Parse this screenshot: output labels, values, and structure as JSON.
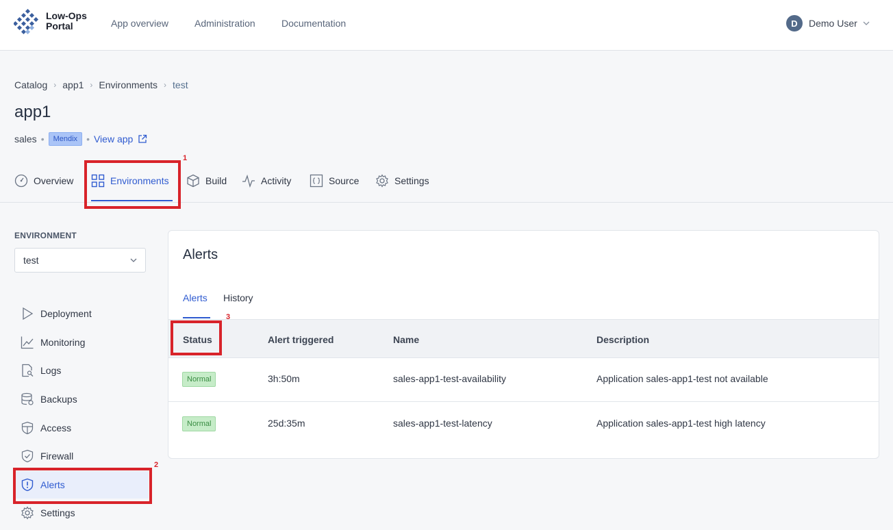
{
  "brand": {
    "line1": "Low-Ops",
    "line2": "Portal"
  },
  "topnav": {
    "links": [
      "App overview",
      "Administration",
      "Documentation"
    ]
  },
  "user": {
    "initial": "D",
    "name": "Demo User"
  },
  "breadcrumb": [
    "Catalog",
    "app1",
    "Environments",
    "test"
  ],
  "page": {
    "title": "app1",
    "team": "sales",
    "badge": "Mendix",
    "view_link": "View app"
  },
  "tabs": [
    "Overview",
    "Environments",
    "Build",
    "Activity",
    "Source",
    "Settings"
  ],
  "sidebar": {
    "env_label": "ENVIRONMENT",
    "env_value": "test",
    "items": [
      "Deployment",
      "Monitoring",
      "Logs",
      "Backups",
      "Access",
      "Firewall",
      "Alerts",
      "Settings"
    ]
  },
  "alerts": {
    "title": "Alerts",
    "subtabs": [
      "Alerts",
      "History"
    ],
    "columns": [
      "Status",
      "Alert triggered",
      "Name",
      "Description"
    ],
    "rows": [
      {
        "status": "Normal",
        "triggered": "3h:50m",
        "name": "sales-app1-test-availability",
        "description": "Application sales-app1-test not available"
      },
      {
        "status": "Normal",
        "triggered": "25d:35m",
        "name": "sales-app1-test-latency",
        "description": "Application sales-app1-test high latency"
      }
    ]
  },
  "annotations": [
    "1",
    "2",
    "3"
  ],
  "colors": {
    "accent": "#2f5bd0",
    "annotation": "#d8232a",
    "status_ok": "#3a8d43"
  }
}
